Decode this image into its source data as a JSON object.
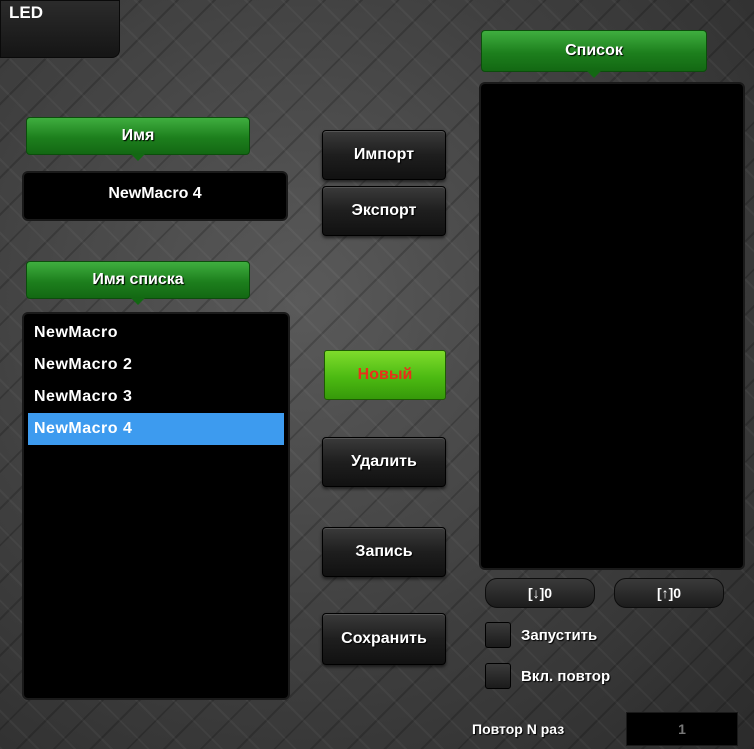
{
  "led_tab": {
    "label": "LED"
  },
  "name_section": {
    "header": "Имя",
    "value": "NewMacro 4"
  },
  "list_name_section": {
    "header": "Имя списка",
    "items": [
      {
        "label": "NewMacro",
        "selected": false
      },
      {
        "label": "NewMacro 2",
        "selected": false
      },
      {
        "label": "NewMacro 3",
        "selected": false
      },
      {
        "label": "NewMacro 4",
        "selected": true
      }
    ]
  },
  "buttons": {
    "import": "Импорт",
    "export": "Экспорт",
    "new": "Новый",
    "delete": "Удалить",
    "record": "Запись",
    "save": "Сохранить"
  },
  "list_section": {
    "header": "Список"
  },
  "counters": {
    "down": "[↓]0",
    "up": "[↑]0"
  },
  "options": {
    "run": "Запустить",
    "repeat_enable": "Вкл. повтор"
  },
  "repeat_count": {
    "label": "Повтор N раз",
    "value": "1"
  },
  "colors": {
    "accent_green": "#1d7f1d",
    "new_button_green": "#4cba12",
    "new_button_text": "#e8301a",
    "selection_blue": "#3d9bef"
  }
}
